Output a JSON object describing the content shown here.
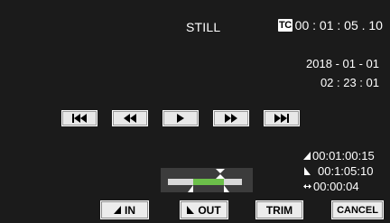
{
  "header": {
    "mode": "STILL",
    "tc_badge": "TC",
    "timecode": "00 : 01 : 05 . 10",
    "date": "2018 - 01 - 01",
    "time": "02 : 23 : 01"
  },
  "transport": {
    "buttons": [
      {
        "icon": "skip-back-icon"
      },
      {
        "icon": "rewind-icon"
      },
      {
        "icon": "play-icon"
      },
      {
        "icon": "fast-forward-icon"
      },
      {
        "icon": "skip-forward-icon"
      }
    ]
  },
  "info": {
    "in_point": "00:01:00:15",
    "out_point": "00:1:05:10",
    "duration": "00:00:04"
  },
  "trim_bar": {
    "in_fraction": 0.34,
    "out_fraction": 0.76,
    "playhead_fraction": 0.71,
    "colors": {
      "range": "#6cc04a",
      "track": "#d8d8d8"
    }
  },
  "buttons": {
    "in_label": "IN",
    "out_label": "OUT",
    "trim_label": "TRIM",
    "cancel_label": "CANCEL"
  }
}
